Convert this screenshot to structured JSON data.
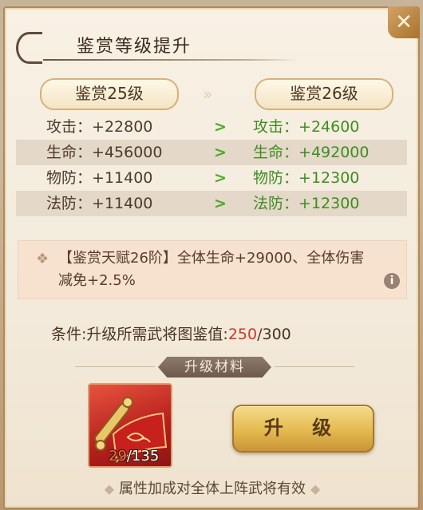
{
  "title": "鉴赏等级提升",
  "levels": {
    "current": "鉴赏25级",
    "next": "鉴赏26级",
    "arrow": "»"
  },
  "stats": [
    {
      "label": "攻击",
      "current": "+22800",
      "next": "+24600"
    },
    {
      "label": "生命",
      "current": "+456000",
      "next": "+492000"
    },
    {
      "label": "物防",
      "current": "+11400",
      "next": "+12300"
    },
    {
      "label": "法防",
      "current": "+11400",
      "next": "+12300"
    }
  ],
  "stat_sep": "：",
  "row_arrow": ">",
  "talent": {
    "text": "【鉴赏天赋26阶】全体生命+29000、全体伤害减免+2.5%",
    "info_glyph": "i"
  },
  "condition": {
    "label": "条件:升级所需武将图鉴值:",
    "current": "250",
    "required": "/300"
  },
  "materials": {
    "label": "升级材料",
    "item_have": "29",
    "item_need": "/135"
  },
  "upgrade_button": "升 级",
  "footnote": "属性加成对全体上阵武将有效",
  "close_glyph": "✕",
  "colors": {
    "accent_green": "#3e8d22",
    "count_red": "#c8372a",
    "button_gold": "#e3b950"
  }
}
